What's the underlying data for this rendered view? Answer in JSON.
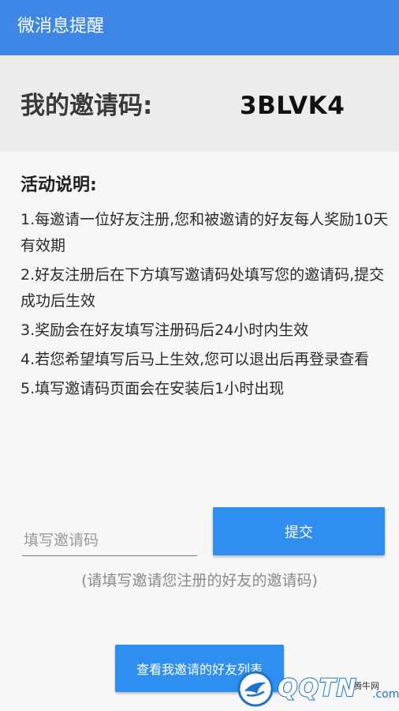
{
  "app_bar": {
    "title": "微消息提醒"
  },
  "invite": {
    "label": "我的邀请码:",
    "code": "3BLVK4"
  },
  "activity": {
    "title": "活动说明:",
    "rules": [
      "1.每邀请一位好友注册,您和被邀请的好友每人奖励10天有效期",
      "2.好友注册后在下方填写邀请码处填写您的邀请码,提交成功后生效",
      "3.奖励会在好友填写注册码后24小时内生效",
      "4.若您希望填写后马上生效,您可以退出后再登录查看",
      "5.填写邀请码页面会在安装后1小时出现"
    ]
  },
  "form": {
    "input_value": "",
    "input_placeholder": "填写邀请码",
    "submit_label": "提交",
    "hint": "(请填写邀请您注册的好友的邀请码)"
  },
  "friends_button": {
    "label": "查看我邀请的好友列表"
  },
  "watermark": {
    "top_text": "腾牛网",
    "brand": "QQTN",
    "domain": ".com",
    "icon": "bird-logo-icon"
  },
  "colors": {
    "app_bar": "#3f87e6",
    "button": "#2f8ff0",
    "watermark": "#1e73c9"
  }
}
